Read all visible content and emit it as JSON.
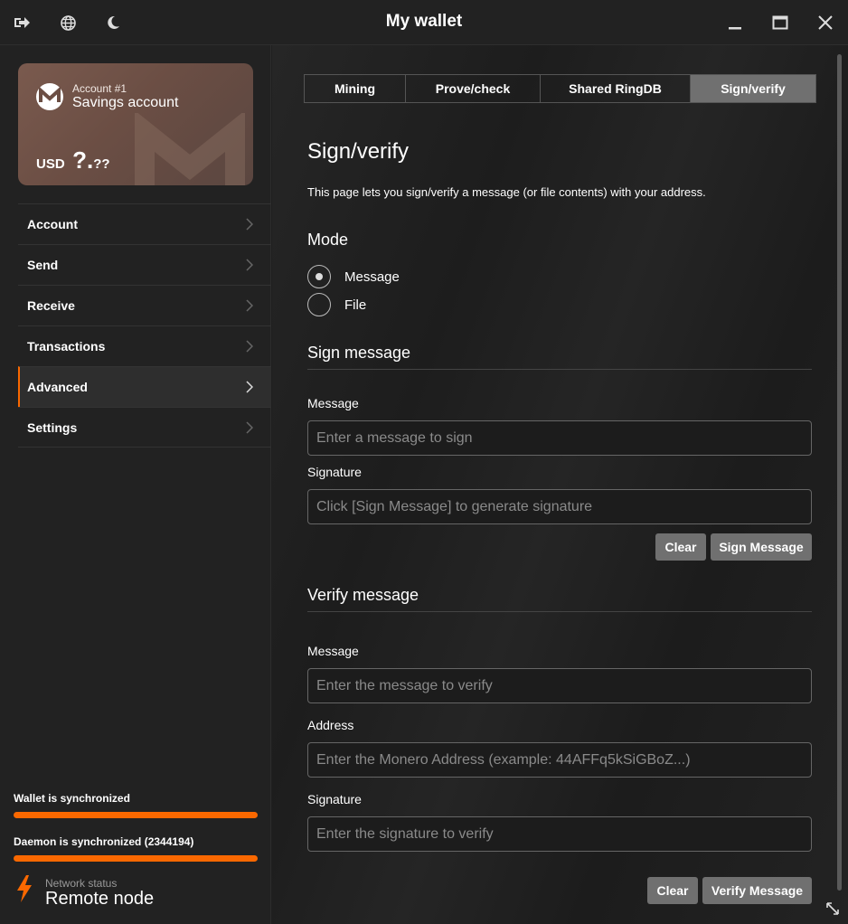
{
  "titlebar": {
    "title": "My wallet",
    "icons": [
      "logout-icon",
      "globe-icon",
      "moon-icon",
      "minimize-icon",
      "maximize-icon",
      "close-icon"
    ]
  },
  "account_card": {
    "account_number": "Account #1",
    "account_name": "Savings account",
    "currency": "USD",
    "balance_main": "?.",
    "balance_fraction": "??"
  },
  "menu": {
    "items": [
      {
        "label": "Account"
      },
      {
        "label": "Send"
      },
      {
        "label": "Receive"
      },
      {
        "label": "Transactions"
      },
      {
        "label": "Advanced",
        "active": true
      },
      {
        "label": "Settings"
      }
    ]
  },
  "status": {
    "wallet_sync": "Wallet is synchronized",
    "wallet_progress": 1.0,
    "daemon_sync": "Daemon is synchronized (2344194)",
    "daemon_progress": 1.0,
    "network_label": "Network status",
    "network_value": "Remote node"
  },
  "tabs": [
    {
      "label": "Mining"
    },
    {
      "label": "Prove/check"
    },
    {
      "label": "Shared RingDB"
    },
    {
      "label": "Sign/verify",
      "active": true
    }
  ],
  "page": {
    "title": "Sign/verify",
    "description": "This page lets you sign/verify a message (or file contents) with your address.",
    "mode_heading": "Mode",
    "mode_options": [
      "Message",
      "File"
    ],
    "mode_selected": "Message"
  },
  "sign": {
    "heading": "Sign message",
    "message_label": "Message",
    "message_placeholder": "Enter a message to sign",
    "signature_label": "Signature",
    "signature_placeholder": "Click [Sign Message] to generate signature",
    "clear_label": "Clear",
    "sign_label": "Sign Message"
  },
  "verify": {
    "heading": "Verify message",
    "message_label": "Message",
    "message_placeholder": "Enter the message to verify",
    "address_label": "Address",
    "address_placeholder": "Enter the Monero Address (example: 44AFFq5kSiGBoZ...)",
    "signature_label": "Signature",
    "signature_placeholder": "Enter the signature to verify",
    "clear_label": "Clear",
    "verify_label": "Verify Message"
  },
  "colors": {
    "accent": "#fa6800",
    "active_tab": "#707070",
    "button": "#707070"
  }
}
